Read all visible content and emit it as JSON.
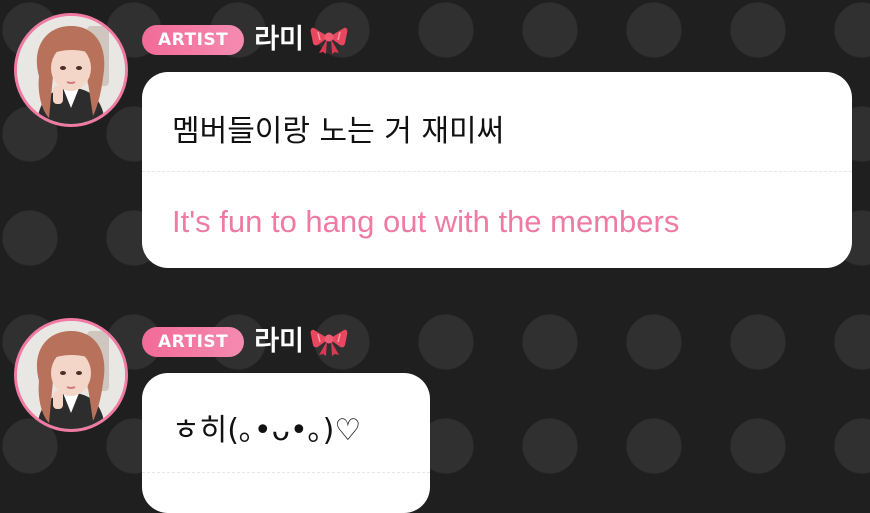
{
  "messages": [
    {
      "badge": "ARTIST",
      "sender": "라미",
      "sender_icon": "ribbon-bow-icon",
      "text": "멤버들이랑 노는 거 재미써",
      "translation": "It's fun to hang out with the members"
    },
    {
      "badge": "ARTIST",
      "sender": "라미",
      "sender_icon": "ribbon-bow-icon",
      "text": "ㅎ히(｡•ᴗ•｡)♡"
    }
  ],
  "colors": {
    "background": "#1f1f1f",
    "badge": "#f26a98",
    "avatar_ring": "#f07aa3",
    "translation_text": "#ef7aa2",
    "bubble": "#ffffff"
  }
}
